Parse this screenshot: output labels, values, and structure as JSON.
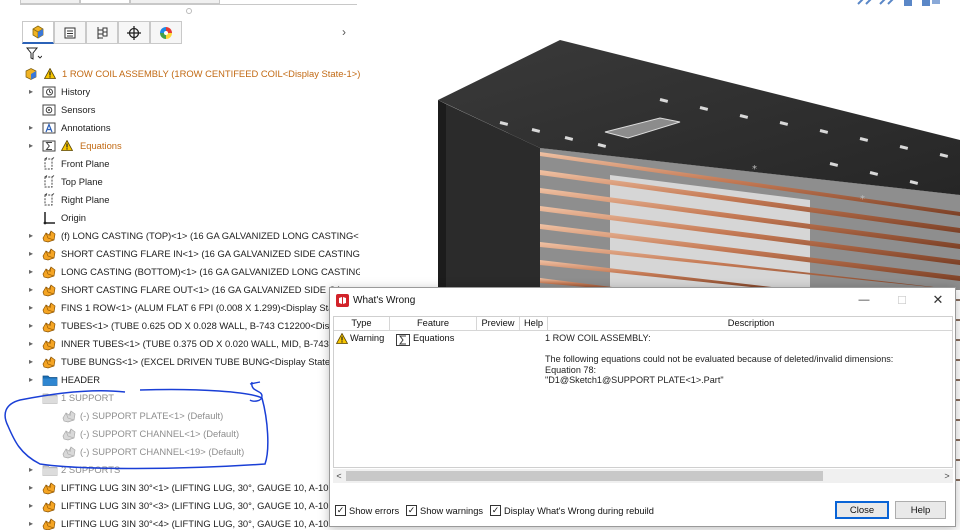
{
  "colors": {
    "accent": "#2b62b8",
    "warning": "#f2c200",
    "orange_part": "#e8901a",
    "annotation_ink": "#1a3fd6"
  },
  "feature_manager": {
    "tabs": [
      "feature-manager-tab",
      "property-manager-tab",
      "configuration-manager-tab",
      "dimxpert-tab",
      "display-manager-tab"
    ],
    "more_arrow": "›",
    "tree": [
      {
        "label": "1 ROW COIL ASSEMBLY  (1ROW CENTIFEED COIL<Display State-1>)",
        "icon": "assembly-icon",
        "warn": true,
        "kind": "root"
      },
      {
        "label": "History",
        "icon": "history-icon",
        "kind": "folder",
        "arrow": true
      },
      {
        "label": "Sensors",
        "icon": "sensors-icon",
        "kind": "folder",
        "arrow": false
      },
      {
        "label": "Annotations",
        "icon": "annotations-icon",
        "kind": "folder",
        "arrow": true
      },
      {
        "label": "Equations",
        "icon": "equations-icon",
        "kind": "folder",
        "arrow": true,
        "warn": true,
        "orange": true
      },
      {
        "label": "Front Plane",
        "icon": "plane-icon",
        "kind": "plane",
        "arrow": false
      },
      {
        "label": "Top Plane",
        "icon": "plane-icon",
        "kind": "plane",
        "arrow": false
      },
      {
        "label": "Right Plane",
        "icon": "plane-icon",
        "kind": "plane",
        "arrow": false
      },
      {
        "label": "Origin",
        "icon": "origin-icon",
        "kind": "plane",
        "arrow": false
      },
      {
        "label": "(f) LONG CASTING (TOP)<1> (16 GA GALVANIZED LONG CASTING<",
        "icon": "part-icon",
        "kind": "part",
        "arrow": true
      },
      {
        "label": "SHORT CASTING FLARE IN<1> (16 GA GALVANIZED SIDE CASTING<",
        "icon": "part-icon",
        "kind": "part",
        "arrow": true
      },
      {
        "label": "LONG CASTING (BOTTOM)<1> (16 GA GALVANIZED LONG CASTING",
        "icon": "part-icon",
        "kind": "part",
        "arrow": true
      },
      {
        "label": "SHORT CASTING FLARE OUT<1> (16 GA GALVANIZED SIDE CA",
        "icon": "part-icon",
        "kind": "part",
        "arrow": true
      },
      {
        "label": "FINS 1 ROW<1> (ALUM FLAT 6 FPI (0.008 X 1.299)<Display Sta",
        "icon": "part-icon",
        "kind": "part",
        "arrow": true
      },
      {
        "label": "TUBES<1> (TUBE 0.625 OD X 0.028 WALL, B-743 C12200<Displ",
        "icon": "part-icon",
        "kind": "part",
        "arrow": true
      },
      {
        "label": "INNER TUBES<1> (TUBE 0.375 OD X 0.020 WALL, MID, B-743 C",
        "icon": "part-icon",
        "kind": "part",
        "arrow": true
      },
      {
        "label": "TUBE BUNGS<1> (EXCEL DRIVEN TUBE BUNG<Display State-7",
        "icon": "part-icon",
        "kind": "part",
        "arrow": true
      },
      {
        "label": "HEADER",
        "icon": "folder-icon",
        "kind": "folderblue",
        "arrow": true
      },
      {
        "label": "1 SUPPORT",
        "icon": "folder-icon",
        "kind": "foldergray",
        "arrow": false,
        "suppressed": true
      },
      {
        "label": "(-) SUPPORT PLATE<1> (Default)",
        "icon": "part-icon",
        "kind": "subpart",
        "suppressed": true
      },
      {
        "label": "(-) SUPPORT CHANNEL<1> (Default)",
        "icon": "part-icon",
        "kind": "subpart",
        "suppressed": true
      },
      {
        "label": "(-) SUPPORT CHANNEL<19> (Default)",
        "icon": "part-icon",
        "kind": "subpart",
        "suppressed": true
      },
      {
        "label": "2 SUPPORTS",
        "icon": "folder-icon",
        "kind": "foldergray",
        "arrow": true,
        "suppressed": true
      },
      {
        "label": "LIFTING LUG 3IN 30°<1> (LIFTING LUG,  30°,  GAUGE 10, A-101",
        "icon": "part-icon",
        "kind": "part",
        "arrow": true
      },
      {
        "label": "LIFTING LUG 3IN 30°<3> (LIFTING LUG,  30°,  GAUGE 10, A-101",
        "icon": "part-icon",
        "kind": "part",
        "arrow": true
      },
      {
        "label": "LIFTING LUG 3IN 30°<4> (LIFTING LUG,  30°,  GAUGE 10, A-101",
        "icon": "part-icon",
        "kind": "part",
        "arrow": true
      }
    ]
  },
  "annotation": {
    "mark": "5"
  },
  "dialog": {
    "title": "What's Wrong",
    "controls": {
      "minimize": "—",
      "maximize": "☐",
      "close": "✕"
    },
    "columns": [
      "Type",
      "Feature",
      "Preview",
      "Help",
      "Description"
    ],
    "row": {
      "type": "Warning",
      "feature": "Equations",
      "description_lines": [
        "1 ROW COIL ASSEMBLY:",
        "",
        "The following equations could not be evaluated because of deleted/invalid dimensions:",
        "Equation 78:",
        "\"D1@Sketch1@SUPPORT PLATE<1>.Part\""
      ]
    },
    "scroll_left": "<",
    "scroll_right": ">",
    "checkboxes": [
      {
        "label": "Show errors",
        "checked": true
      },
      {
        "label": "Show warnings",
        "checked": true
      },
      {
        "label": "Display What's Wrong during rebuild",
        "checked": true
      }
    ],
    "buttons": {
      "close": "Close",
      "help": "Help"
    }
  }
}
